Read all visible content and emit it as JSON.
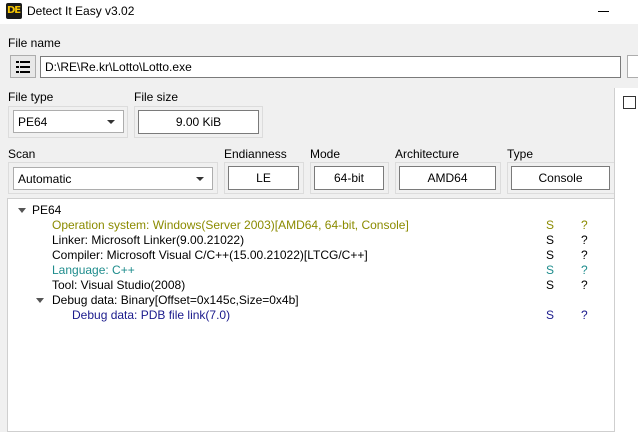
{
  "window": {
    "title": "Detect It Easy v3.02",
    "icon_text": "DE"
  },
  "file": {
    "label": "File name",
    "path": "D:\\RE\\Re.kr\\Lotto\\Lotto.exe"
  },
  "file_type": {
    "label": "File type",
    "value": "PE64"
  },
  "file_size": {
    "label": "File size",
    "value": "9.00 KiB"
  },
  "scan": {
    "label": "Scan",
    "value": "Automatic"
  },
  "endianness": {
    "label": "Endianness",
    "value": "LE"
  },
  "mode": {
    "label": "Mode",
    "value": "64-bit"
  },
  "architecture": {
    "label": "Architecture",
    "value": "AMD64"
  },
  "type": {
    "label": "Type",
    "value": "Console"
  },
  "colors": {
    "os": "#8b8b00",
    "language": "#1e8c8c",
    "debug_link": "#1a1a8c",
    "normal": "#000000"
  },
  "results": {
    "root": "PE64",
    "rows": [
      {
        "text": "Operation system: Windows(Server 2003)[AMD64, 64-bit, Console]",
        "s": "S",
        "q": "?"
      },
      {
        "text": "Linker: Microsoft Linker(9.00.21022)",
        "s": "S",
        "q": "?"
      },
      {
        "text": "Compiler: Microsoft Visual C/C++(15.00.21022)[LTCG/C++]",
        "s": "S",
        "q": "?"
      },
      {
        "text": "Language: C++",
        "s": "S",
        "q": "?"
      },
      {
        "text": "Tool: Visual Studio(2008)",
        "s": "S",
        "q": "?"
      },
      {
        "text": "Debug data: Binary[Offset=0x145c,Size=0x4b]"
      },
      {
        "text": "Debug data: PDB file link(7.0)",
        "s": "S",
        "q": "?"
      }
    ]
  }
}
